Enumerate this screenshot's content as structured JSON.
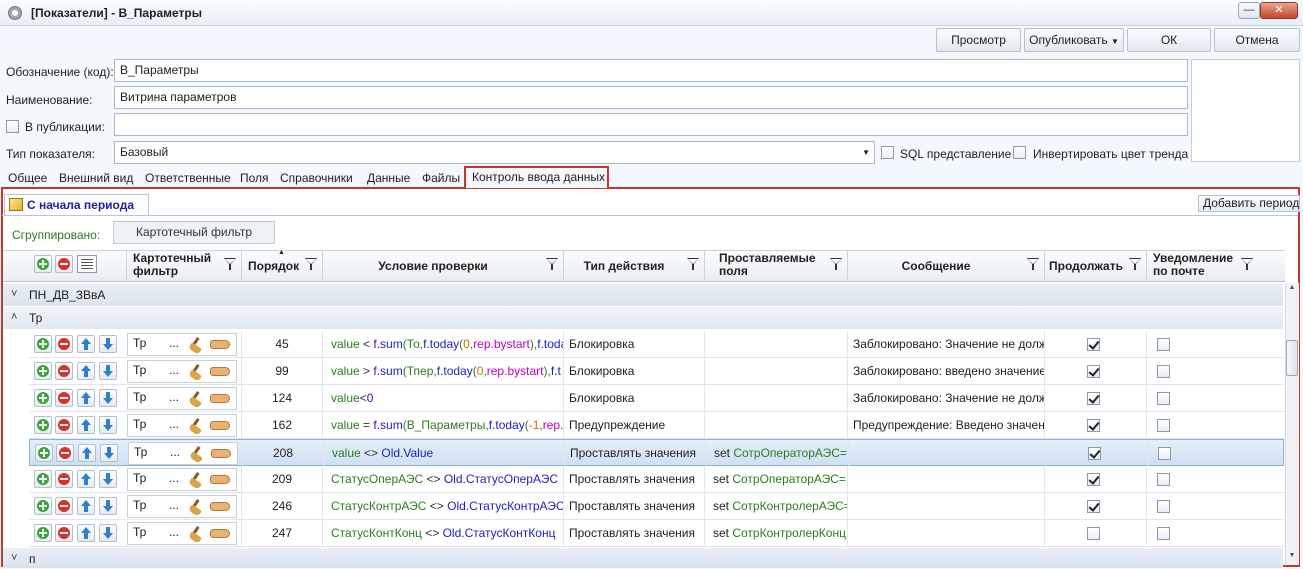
{
  "window": {
    "title": "[Показатели] - В_Параметры"
  },
  "toolbar": {
    "preview": "Просмотр",
    "publish": "Опубликовать",
    "ok": "ОК",
    "cancel": "Отмена"
  },
  "form": {
    "code_label": "Обозначение (код):",
    "code_value": "В_Параметры",
    "name_label": "Наименование:",
    "name_value": "Витрина параметров",
    "publication_label": "В публикации:",
    "publication_value": "",
    "type_label": "Тип показателя:",
    "type_value": "Базовый",
    "sql_view_label": "SQL представление",
    "invert_trend_label": "Инвертировать цвет тренда"
  },
  "tabs": [
    "Общее",
    "Внешний вид",
    "Ответственные",
    "Поля",
    "Справочники",
    "Данные",
    "Файлы",
    "Контроль ввода данных"
  ],
  "subtab": {
    "label": "С начала периода",
    "add_period": "Добавить период"
  },
  "grouping": {
    "label": "Сгруппировано:",
    "chip": "Картотечный фильтр"
  },
  "columns": {
    "card_filter": "Картотечный фильтр",
    "order": "Порядок",
    "condition": "Условие проверки",
    "action_type": "Тип действия",
    "fields": "Проставляемые поля",
    "message": "Сообщение",
    "continue": "Продолжать",
    "email": "Уведомление по почте"
  },
  "groups": {
    "top": "ПН_ДВ_ЗВвА",
    "sub": "Тр",
    "next": "п"
  },
  "rows": [
    {
      "filter": "Тр",
      "dots": "...",
      "order": "45",
      "condition": [
        "value",
        " < ",
        "f.sum",
        "(То,",
        "f.today",
        "(",
        "0",
        ",",
        "rep.bystart",
        "),",
        "f.toda"
      ],
      "action": "Блокировка",
      "fields_k": "",
      "fields_v": "",
      "message": "Заблокировано: Значение не долж",
      "continue": true,
      "email": false
    },
    {
      "filter": "Тр",
      "dots": "...",
      "order": "99",
      "condition": [
        "value",
        " > ",
        "f.sum",
        "(Тпер,",
        "f.today",
        "(",
        "0",
        ",",
        "rep.bystart",
        "),",
        "f.t"
      ],
      "action": "Блокировка",
      "fields_k": "",
      "fields_v": "",
      "message": "Заблокировано: введено значение",
      "continue": true,
      "email": false
    },
    {
      "filter": "Тр",
      "dots": "...",
      "order": "124",
      "condition": [
        "value",
        "<",
        "0",
        "",
        "",
        "",
        "",
        "",
        "",
        "",
        ""
      ],
      "action": "Блокировка",
      "fields_k": "",
      "fields_v": "",
      "message": "Заблокировано: Значение не долж",
      "continue": true,
      "email": false
    },
    {
      "filter": "Тр",
      "dots": "...",
      "order": "162",
      "condition": [
        "value",
        " = ",
        "f.sum",
        "(В_Параметры,",
        "f.today",
        "(",
        "-1",
        ",",
        "rep.b",
        "",
        ""
      ],
      "action": "Предупреждение",
      "fields_k": "",
      "fields_v": "",
      "message": "Предупреждение: Введено значен",
      "continue": true,
      "email": false
    },
    {
      "filter": "Тр",
      "dots": "...",
      "order": "208",
      "condition": [
        "value",
        " <> ",
        "Old.Value",
        "",
        "",
        "",
        "",
        "",
        "",
        "",
        ""
      ],
      "action": "Проставлять значения",
      "fields_k": "set ",
      "fields_v": "СотрОператорАЭС=",
      "message": "",
      "continue": true,
      "email": false,
      "selected": true
    },
    {
      "filter": "Тр",
      "dots": "...",
      "order": "209",
      "condition": [
        "СтатусОперАЭС",
        " <> ",
        "Old.СтатусОперАЭС",
        "",
        "",
        "",
        "",
        "",
        "",
        "",
        ""
      ],
      "action": "Проставлять значения",
      "fields_k": "set ",
      "fields_v": "СотрОператорАЭС=",
      "message": "",
      "continue": true,
      "email": false
    },
    {
      "filter": "Тр",
      "dots": "...",
      "order": "246",
      "condition": [
        "СтатусКонтрАЭС",
        " <> ",
        "Old.СтатусКонтрАЭС",
        "",
        "",
        "",
        "",
        "",
        "",
        "",
        ""
      ],
      "action": "Проставлять значения",
      "fields_k": "set ",
      "fields_v": "СотрКонтролерАЭС=",
      "message": "",
      "continue": true,
      "email": false
    },
    {
      "filter": "Тр",
      "dots": "...",
      "order": "247",
      "condition": [
        "СтатусКонтКонц",
        " <> ",
        "Old.СтатусКонтКонц",
        "",
        "",
        "",
        "",
        "",
        "",
        "",
        ""
      ],
      "action": "Проставлять значения",
      "fields_k": "set ",
      "fields_v": "СотрКонтролерКонц",
      "message": "",
      "continue": false,
      "email": false
    }
  ]
}
